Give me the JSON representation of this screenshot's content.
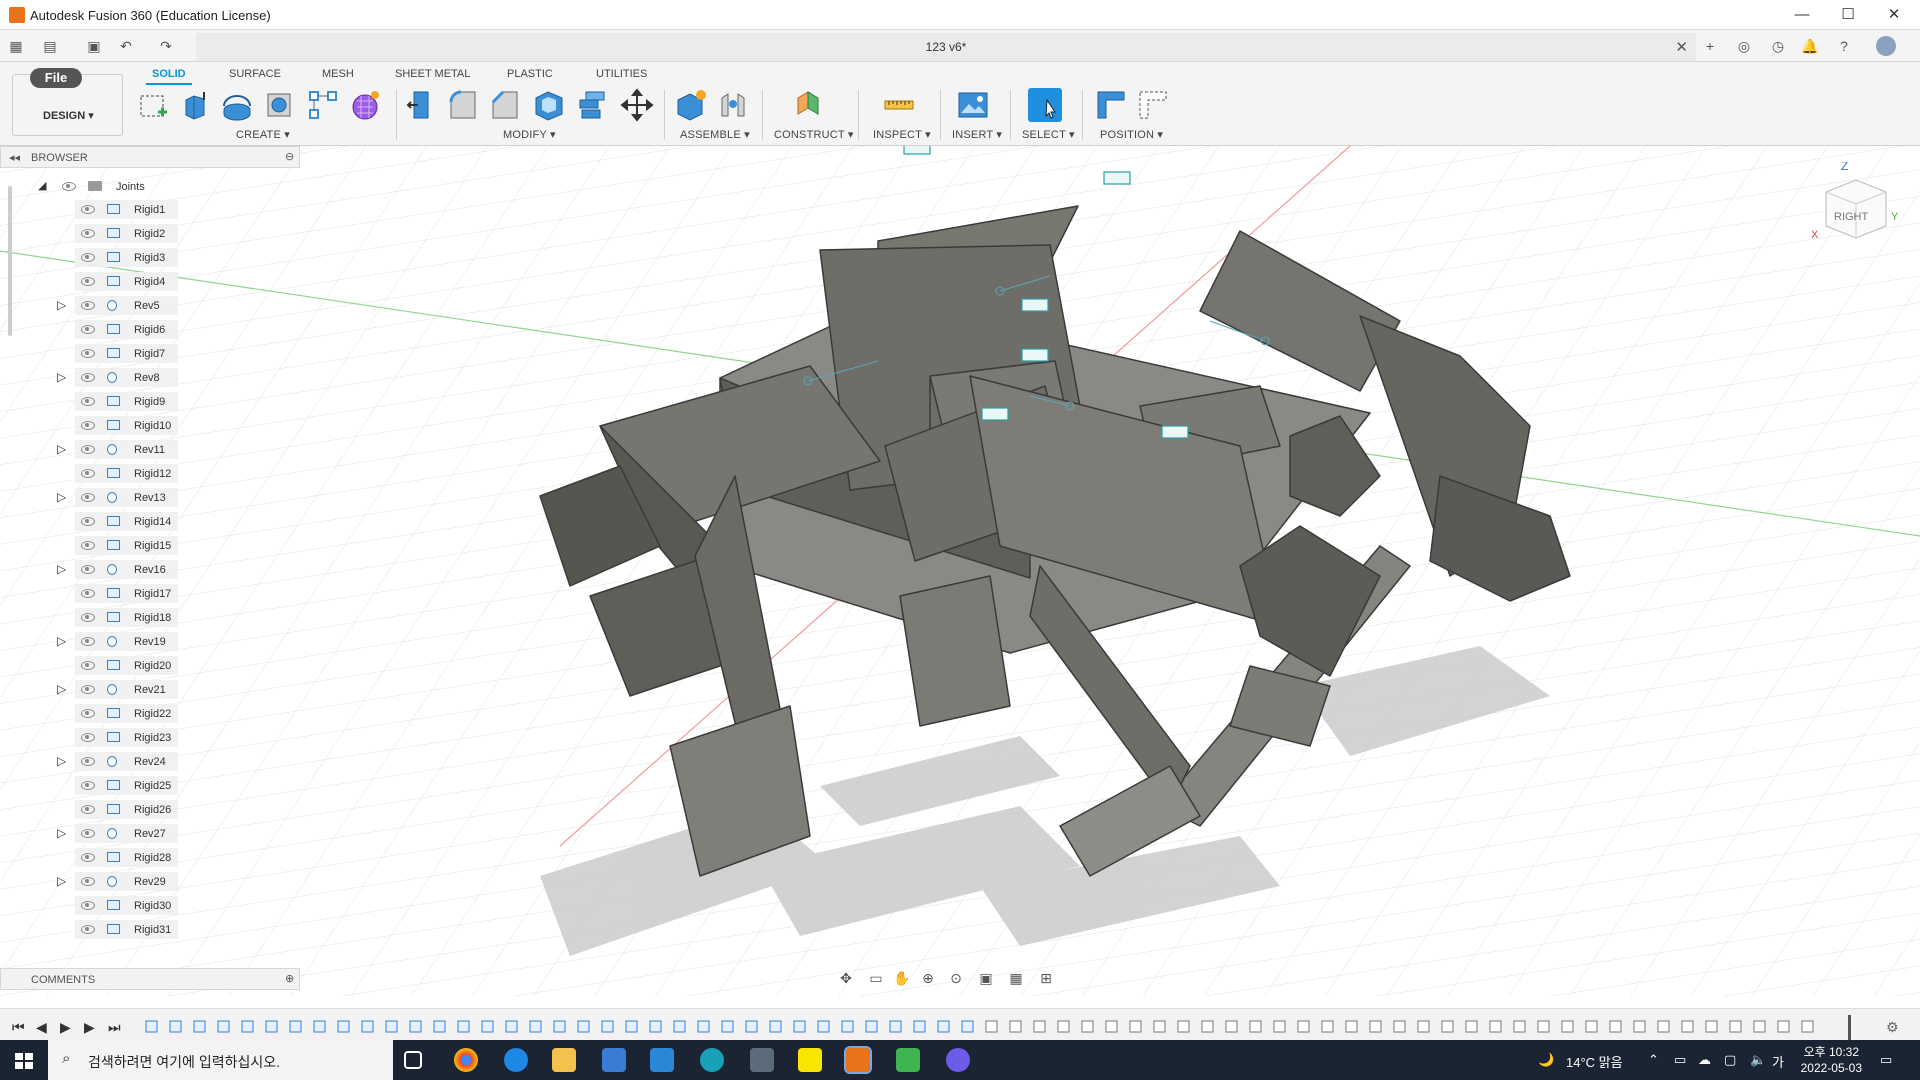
{
  "window": {
    "title": "Autodesk Fusion 360 (Education License)",
    "minimize": "—",
    "maximize": "☐",
    "close": "✕"
  },
  "doc_tab": {
    "name": "123 v6*",
    "close": "✕"
  },
  "ribbon": {
    "file_label": "File",
    "workspace": "DESIGN ▾",
    "tabs": [
      "SOLID",
      "SURFACE",
      "MESH",
      "SHEET METAL",
      "PLASTIC",
      "UTILITIES"
    ],
    "active_tab": "SOLID",
    "groups": [
      "CREATE ▾",
      "MODIFY ▾",
      "ASSEMBLE ▾",
      "CONSTRUCT ▾",
      "INSPECT ▾",
      "INSERT ▾",
      "SELECT ▾",
      "POSITION ▾"
    ]
  },
  "browser": {
    "title": "BROWSER",
    "folder": "Joints",
    "items": [
      {
        "label": "Rigid1",
        "type": "rigid"
      },
      {
        "label": "Rigid2",
        "type": "rigid"
      },
      {
        "label": "Rigid3",
        "type": "rigid"
      },
      {
        "label": "Rigid4",
        "type": "rigid"
      },
      {
        "label": "Rev5",
        "type": "rev"
      },
      {
        "label": "Rigid6",
        "type": "rigid"
      },
      {
        "label": "Rigid7",
        "type": "rigid"
      },
      {
        "label": "Rev8",
        "type": "rev"
      },
      {
        "label": "Rigid9",
        "type": "rigid"
      },
      {
        "label": "Rigid10",
        "type": "rigid"
      },
      {
        "label": "Rev11",
        "type": "rev"
      },
      {
        "label": "Rigid12",
        "type": "rigid"
      },
      {
        "label": "Rev13",
        "type": "rev"
      },
      {
        "label": "Rigid14",
        "type": "rigid"
      },
      {
        "label": "Rigid15",
        "type": "rigid"
      },
      {
        "label": "Rev16",
        "type": "rev"
      },
      {
        "label": "Rigid17",
        "type": "rigid"
      },
      {
        "label": "Rigid18",
        "type": "rigid"
      },
      {
        "label": "Rev19",
        "type": "rev"
      },
      {
        "label": "Rigid20",
        "type": "rigid"
      },
      {
        "label": "Rev21",
        "type": "rev"
      },
      {
        "label": "Rigid22",
        "type": "rigid"
      },
      {
        "label": "Rigid23",
        "type": "rigid"
      },
      {
        "label": "Rev24",
        "type": "rev"
      },
      {
        "label": "Rigid25",
        "type": "rigid"
      },
      {
        "label": "Rigid26",
        "type": "rigid"
      },
      {
        "label": "Rev27",
        "type": "rev"
      },
      {
        "label": "Rigid28",
        "type": "rigid"
      },
      {
        "label": "Rev29",
        "type": "rev"
      },
      {
        "label": "Rigid30",
        "type": "rigid"
      },
      {
        "label": "Rigid31",
        "type": "rigid"
      }
    ]
  },
  "comments": {
    "title": "COMMENTS"
  },
  "viewcube": {
    "face": "RIGHT",
    "axis_z": "Z",
    "axis_x": "X",
    "axis_y": "Y"
  },
  "taskbar": {
    "search_placeholder": "검색하려면 여기에 입력하십시오.",
    "weather": "14°C 맑음",
    "ime": "가",
    "time": "오후 10:32",
    "date": "2022-05-03"
  },
  "colors": {
    "accent": "#0696d7",
    "model": "#6b6a66",
    "taskbar": "#1b2432"
  }
}
